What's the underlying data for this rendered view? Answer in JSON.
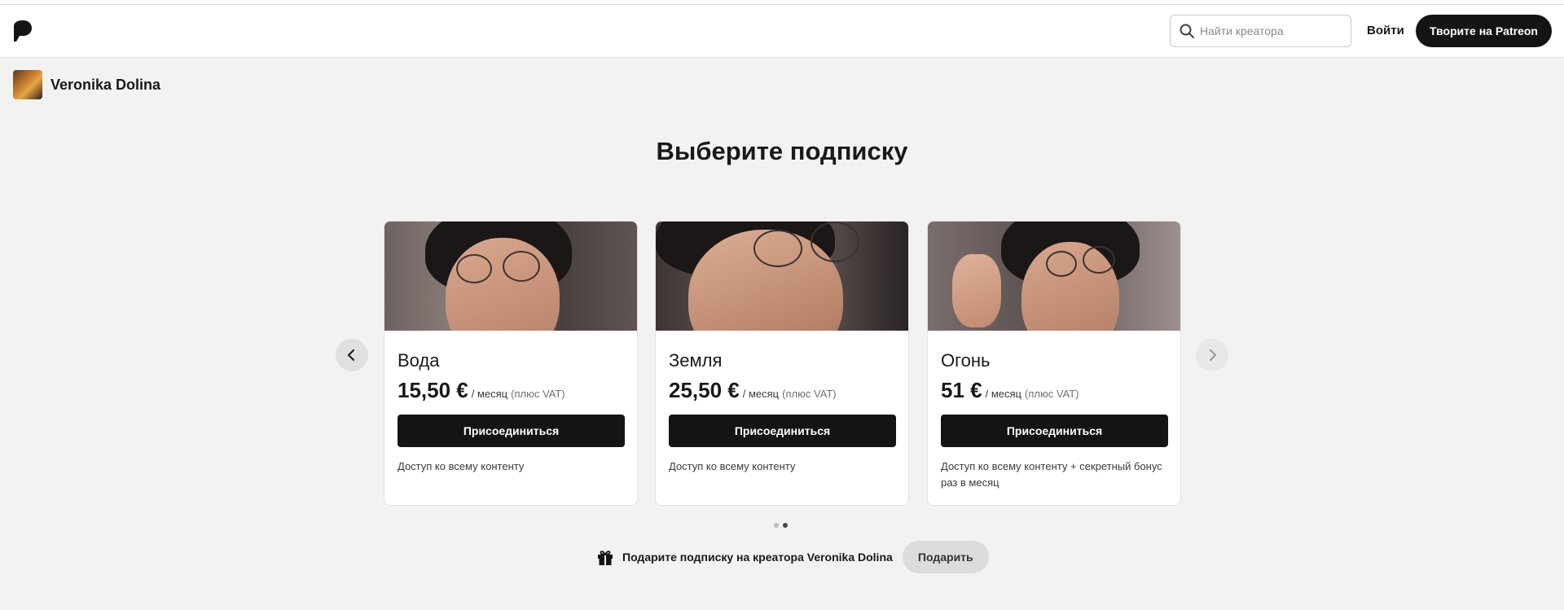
{
  "header": {
    "search_placeholder": "Найти креатора",
    "login_label": "Войти",
    "create_label": "Творите на Patreon"
  },
  "creator": {
    "name": "Veronika Dolina"
  },
  "page": {
    "title": "Выберите подписку"
  },
  "tiers": [
    {
      "name": "Вода",
      "price": "15,50 €",
      "period": "/ месяц",
      "vat": "(плюс VAT)",
      "join_label": "Присоединиться",
      "description": "Доступ ко всему контенту"
    },
    {
      "name": "Земля",
      "price": "25,50 €",
      "period": "/ месяц",
      "vat": "(плюс VAT)",
      "join_label": "Присоединиться",
      "description": "Доступ ко всему контенту"
    },
    {
      "name": "Огонь",
      "price": "51 €",
      "period": "/ месяц",
      "vat": "(плюс VAT)",
      "join_label": "Присоединиться",
      "description": "Доступ ко всему контенту + секретный бонус раз в месяц"
    }
  ],
  "carousel": {
    "page_count": 2,
    "active_page": 2
  },
  "gift": {
    "text": "Подарите подписку на креатора Veronika Dolina",
    "button_label": "Подарить"
  },
  "icons": {
    "logo": "patreon-logo-icon",
    "search": "search-icon",
    "prev": "chevron-left-icon",
    "next": "chevron-right-icon",
    "gift": "gift-icon"
  },
  "colors": {
    "background": "#f2f2f1",
    "primary_button": "#141414",
    "secondary_button": "#dcdcdc"
  }
}
